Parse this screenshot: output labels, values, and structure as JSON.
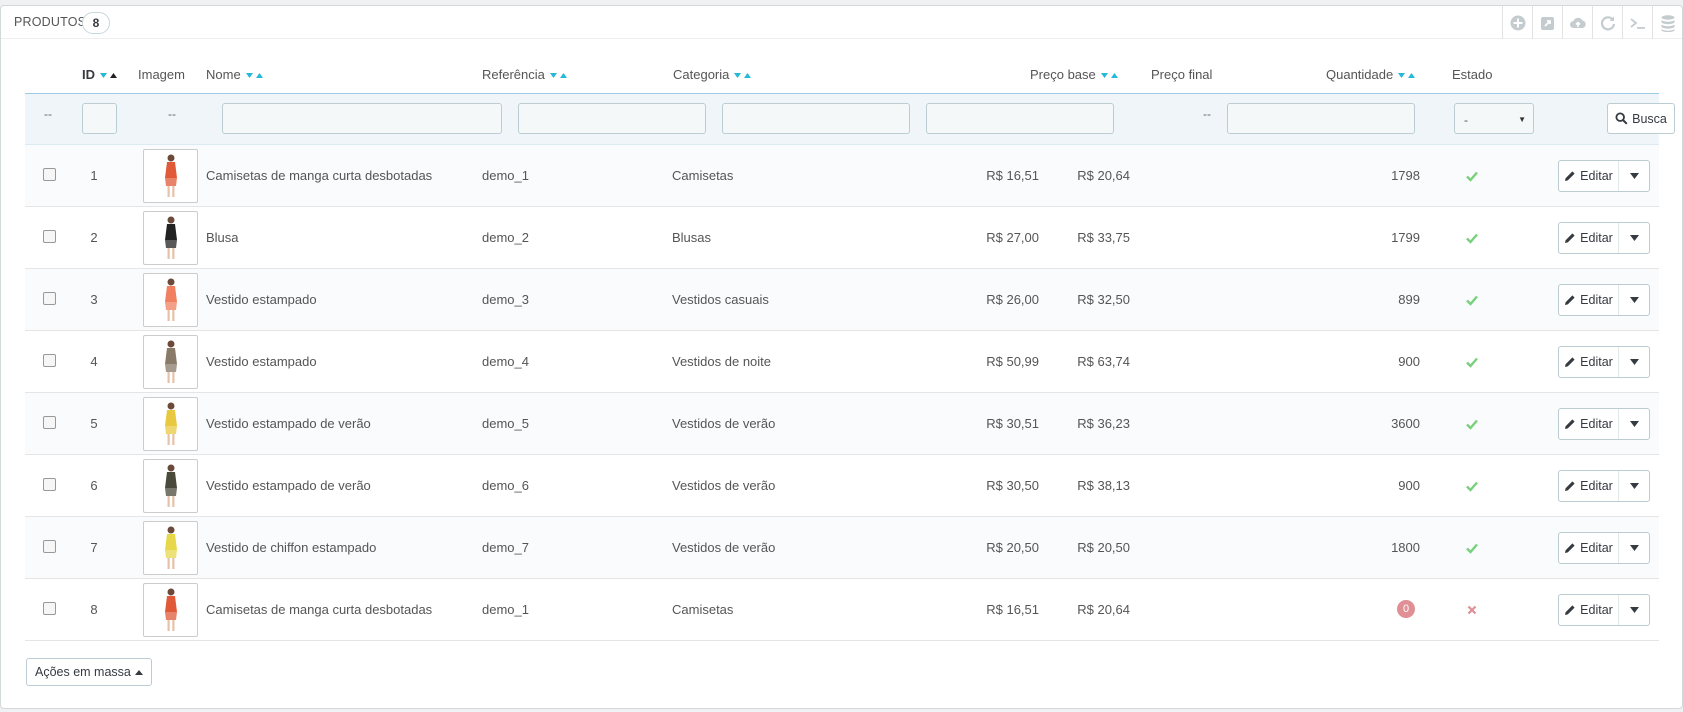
{
  "panel": {
    "title": "Produtos",
    "count": "8"
  },
  "toolbar": [
    {
      "name": "add-icon"
    },
    {
      "name": "export-icon"
    },
    {
      "name": "cloud-upload-icon"
    },
    {
      "name": "refresh-icon"
    },
    {
      "name": "sql-terminal-icon"
    },
    {
      "name": "database-icon"
    }
  ],
  "columns": {
    "id": "ID",
    "image": "Imagem",
    "name": "Nome",
    "reference": "Referência",
    "category": "Categoria",
    "base_price": "Preço base",
    "final_price": "Preço final",
    "quantity": "Quantidade",
    "status": "Estado"
  },
  "filters": {
    "empty_marker": "--",
    "status_select": "-",
    "search_label": "Busca"
  },
  "rows": [
    {
      "id": "1",
      "name": "Camisetas de manga curta desbotadas",
      "reference": "demo_1",
      "category": "Camisetas",
      "base_price": "R$ 16,51",
      "final_price": "R$ 20,64",
      "quantity": "1798",
      "active": true,
      "img_color": "#e05a3a"
    },
    {
      "id": "2",
      "name": "Blusa",
      "reference": "demo_2",
      "category": "Blusas",
      "base_price": "R$ 27,00",
      "final_price": "R$ 33,75",
      "quantity": "1799",
      "active": true,
      "img_color": "#222222"
    },
    {
      "id": "3",
      "name": "Vestido estampado",
      "reference": "demo_3",
      "category": "Vestidos casuais",
      "base_price": "R$ 26,00",
      "final_price": "R$ 32,50",
      "quantity": "899",
      "active": true,
      "img_color": "#f08060"
    },
    {
      "id": "4",
      "name": "Vestido estampado",
      "reference": "demo_4",
      "category": "Vestidos de noite",
      "base_price": "R$ 50,99",
      "final_price": "R$ 63,74",
      "quantity": "900",
      "active": true,
      "img_color": "#8a7a6a"
    },
    {
      "id": "5",
      "name": "Vestido estampado de verão",
      "reference": "demo_5",
      "category": "Vestidos de verão",
      "base_price": "R$ 30,51",
      "final_price": "R$ 36,23",
      "quantity": "3600",
      "active": true,
      "img_color": "#e8c840"
    },
    {
      "id": "6",
      "name": "Vestido estampado de verão",
      "reference": "demo_6",
      "category": "Vestidos de verão",
      "base_price": "R$ 30,50",
      "final_price": "R$ 38,13",
      "quantity": "900",
      "active": true,
      "img_color": "#4a4a3a"
    },
    {
      "id": "7",
      "name": "Vestido de chiffon estampado",
      "reference": "demo_7",
      "category": "Vestidos de verão",
      "base_price": "R$ 20,50",
      "final_price": "R$ 20,50",
      "quantity": "1800",
      "active": true,
      "img_color": "#e6d84a"
    },
    {
      "id": "8",
      "name": "Camisetas de manga curta desbotadas",
      "reference": "demo_1",
      "category": "Camisetas",
      "base_price": "R$ 16,51",
      "final_price": "R$ 20,64",
      "quantity": "0",
      "active": false,
      "img_color": "#e05a3a"
    }
  ],
  "edit_label": "Editar",
  "bulk_actions_label": "Ações em massa",
  "colors": {
    "accent": "#25b9d7",
    "active": "#78d07d",
    "inactive": "#e08f95"
  }
}
